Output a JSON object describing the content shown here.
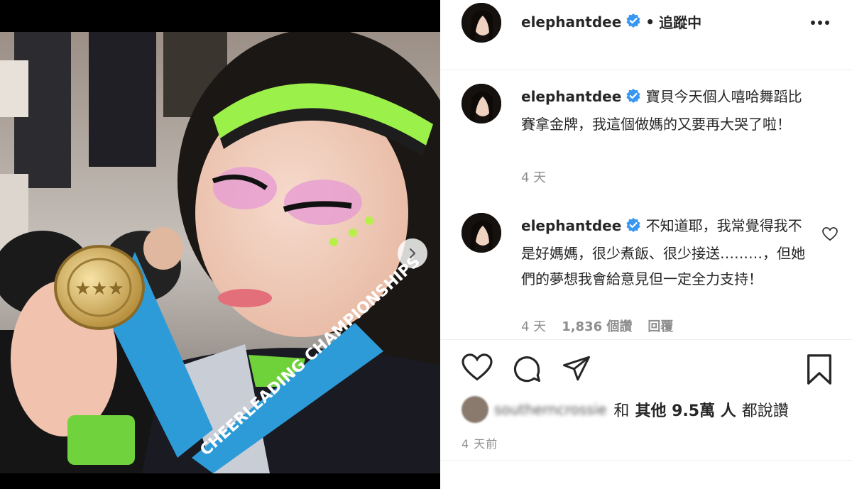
{
  "post": {
    "author": "elephantdee",
    "follow_separator": "•",
    "follow_state": "追蹤中",
    "media": {
      "carousel_next_icon": "chevron-right-icon",
      "medal_ribbon_text": "CHEERLEADING CHAMPIONSHIPS"
    }
  },
  "comments": [
    {
      "username": "elephantdee",
      "text": "寶貝今天個人嘻哈舞蹈比賽拿金牌，我這個做媽的又要再大哭了啦！",
      "time": "4 天"
    },
    {
      "username": "elephantdee",
      "text": "不知道耶，我常覺得我不是好媽媽，很少煮飯、很少接送………，但她們的夢想我會給意見但一定全力支持！",
      "time": "4 天",
      "likes": "1,836 個讚",
      "reply": "回覆"
    }
  ],
  "actions": {
    "like_icon": "heart-icon",
    "comment_icon": "comment-icon",
    "share_icon": "paper-plane-icon",
    "save_icon": "bookmark-icon"
  },
  "likes_summary": {
    "first_liker": "southerncrossie",
    "conjunction": "和",
    "others": "其他 9.5萬 人",
    "suffix": "都說讚"
  },
  "timestamp": "4 天前",
  "colors": {
    "verified_blue": "#3897f0",
    "text_primary": "#262626",
    "text_secondary": "#8e8e8e",
    "divider": "#efefef"
  }
}
